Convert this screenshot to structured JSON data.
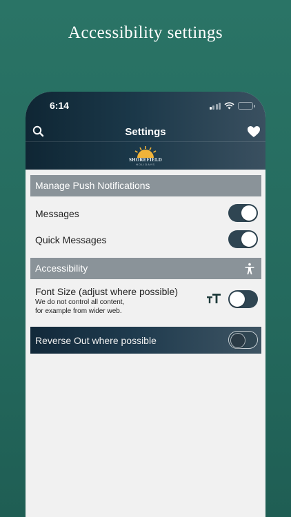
{
  "promo": {
    "title": "Accessibility settings"
  },
  "status_bar": {
    "time": "6:14"
  },
  "nav": {
    "title": "Settings"
  },
  "logo": {
    "name": "SHOREFIELD",
    "sub": "HOLIDAYS"
  },
  "sections": {
    "push": {
      "header": "Manage Push Notifications",
      "messages_label": "Messages",
      "messages_on": true,
      "quick_messages_label": "Quick Messages",
      "quick_messages_on": true
    },
    "accessibility": {
      "header": "Accessibility",
      "font_size_label": "Font Size (adjust where possible)",
      "font_size_sub1": "We do not control all content,",
      "font_size_sub2": "for example from wider web.",
      "font_size_on": false,
      "reverse_label": "Reverse Out where possible",
      "reverse_on": false
    }
  },
  "colors": {
    "background": "#24695d",
    "header_grey": "#8a9399",
    "toggle": "#2f4552"
  },
  "icons": [
    "search-icon",
    "heart-icon",
    "signal-icon",
    "wifi-icon",
    "battery-icon",
    "accessibility-icon",
    "text-size-icon",
    "sun-logo-icon"
  ]
}
